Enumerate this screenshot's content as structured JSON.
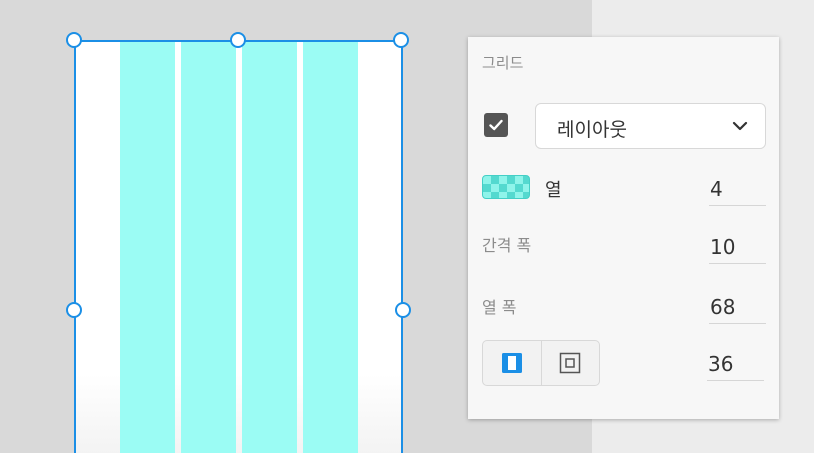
{
  "colors": {
    "canvas": "#d9d9d9",
    "artboard_border": "#1b8fe6",
    "grid_column": "#9bfcf4",
    "panel_bg": "#f7f7f7",
    "accent": "#1b8fe6"
  },
  "artboard": {
    "columns": 4
  },
  "panel": {
    "title": "그리드",
    "layout_enabled": true,
    "layout_dropdown": {
      "selected": "레이아웃",
      "icon": "chevron-down-icon"
    },
    "columns": {
      "label": "열",
      "value": "4"
    },
    "gutter": {
      "label": "간격 폭",
      "value": "10"
    },
    "column_width": {
      "label": "열 폭",
      "value": "68"
    },
    "margins": {
      "value": "36",
      "options": [
        {
          "name": "linked-margins",
          "icon": "vertical-margins-icon",
          "active": true
        },
        {
          "name": "all-margins",
          "icon": "square-margins-icon",
          "active": false
        }
      ]
    }
  }
}
